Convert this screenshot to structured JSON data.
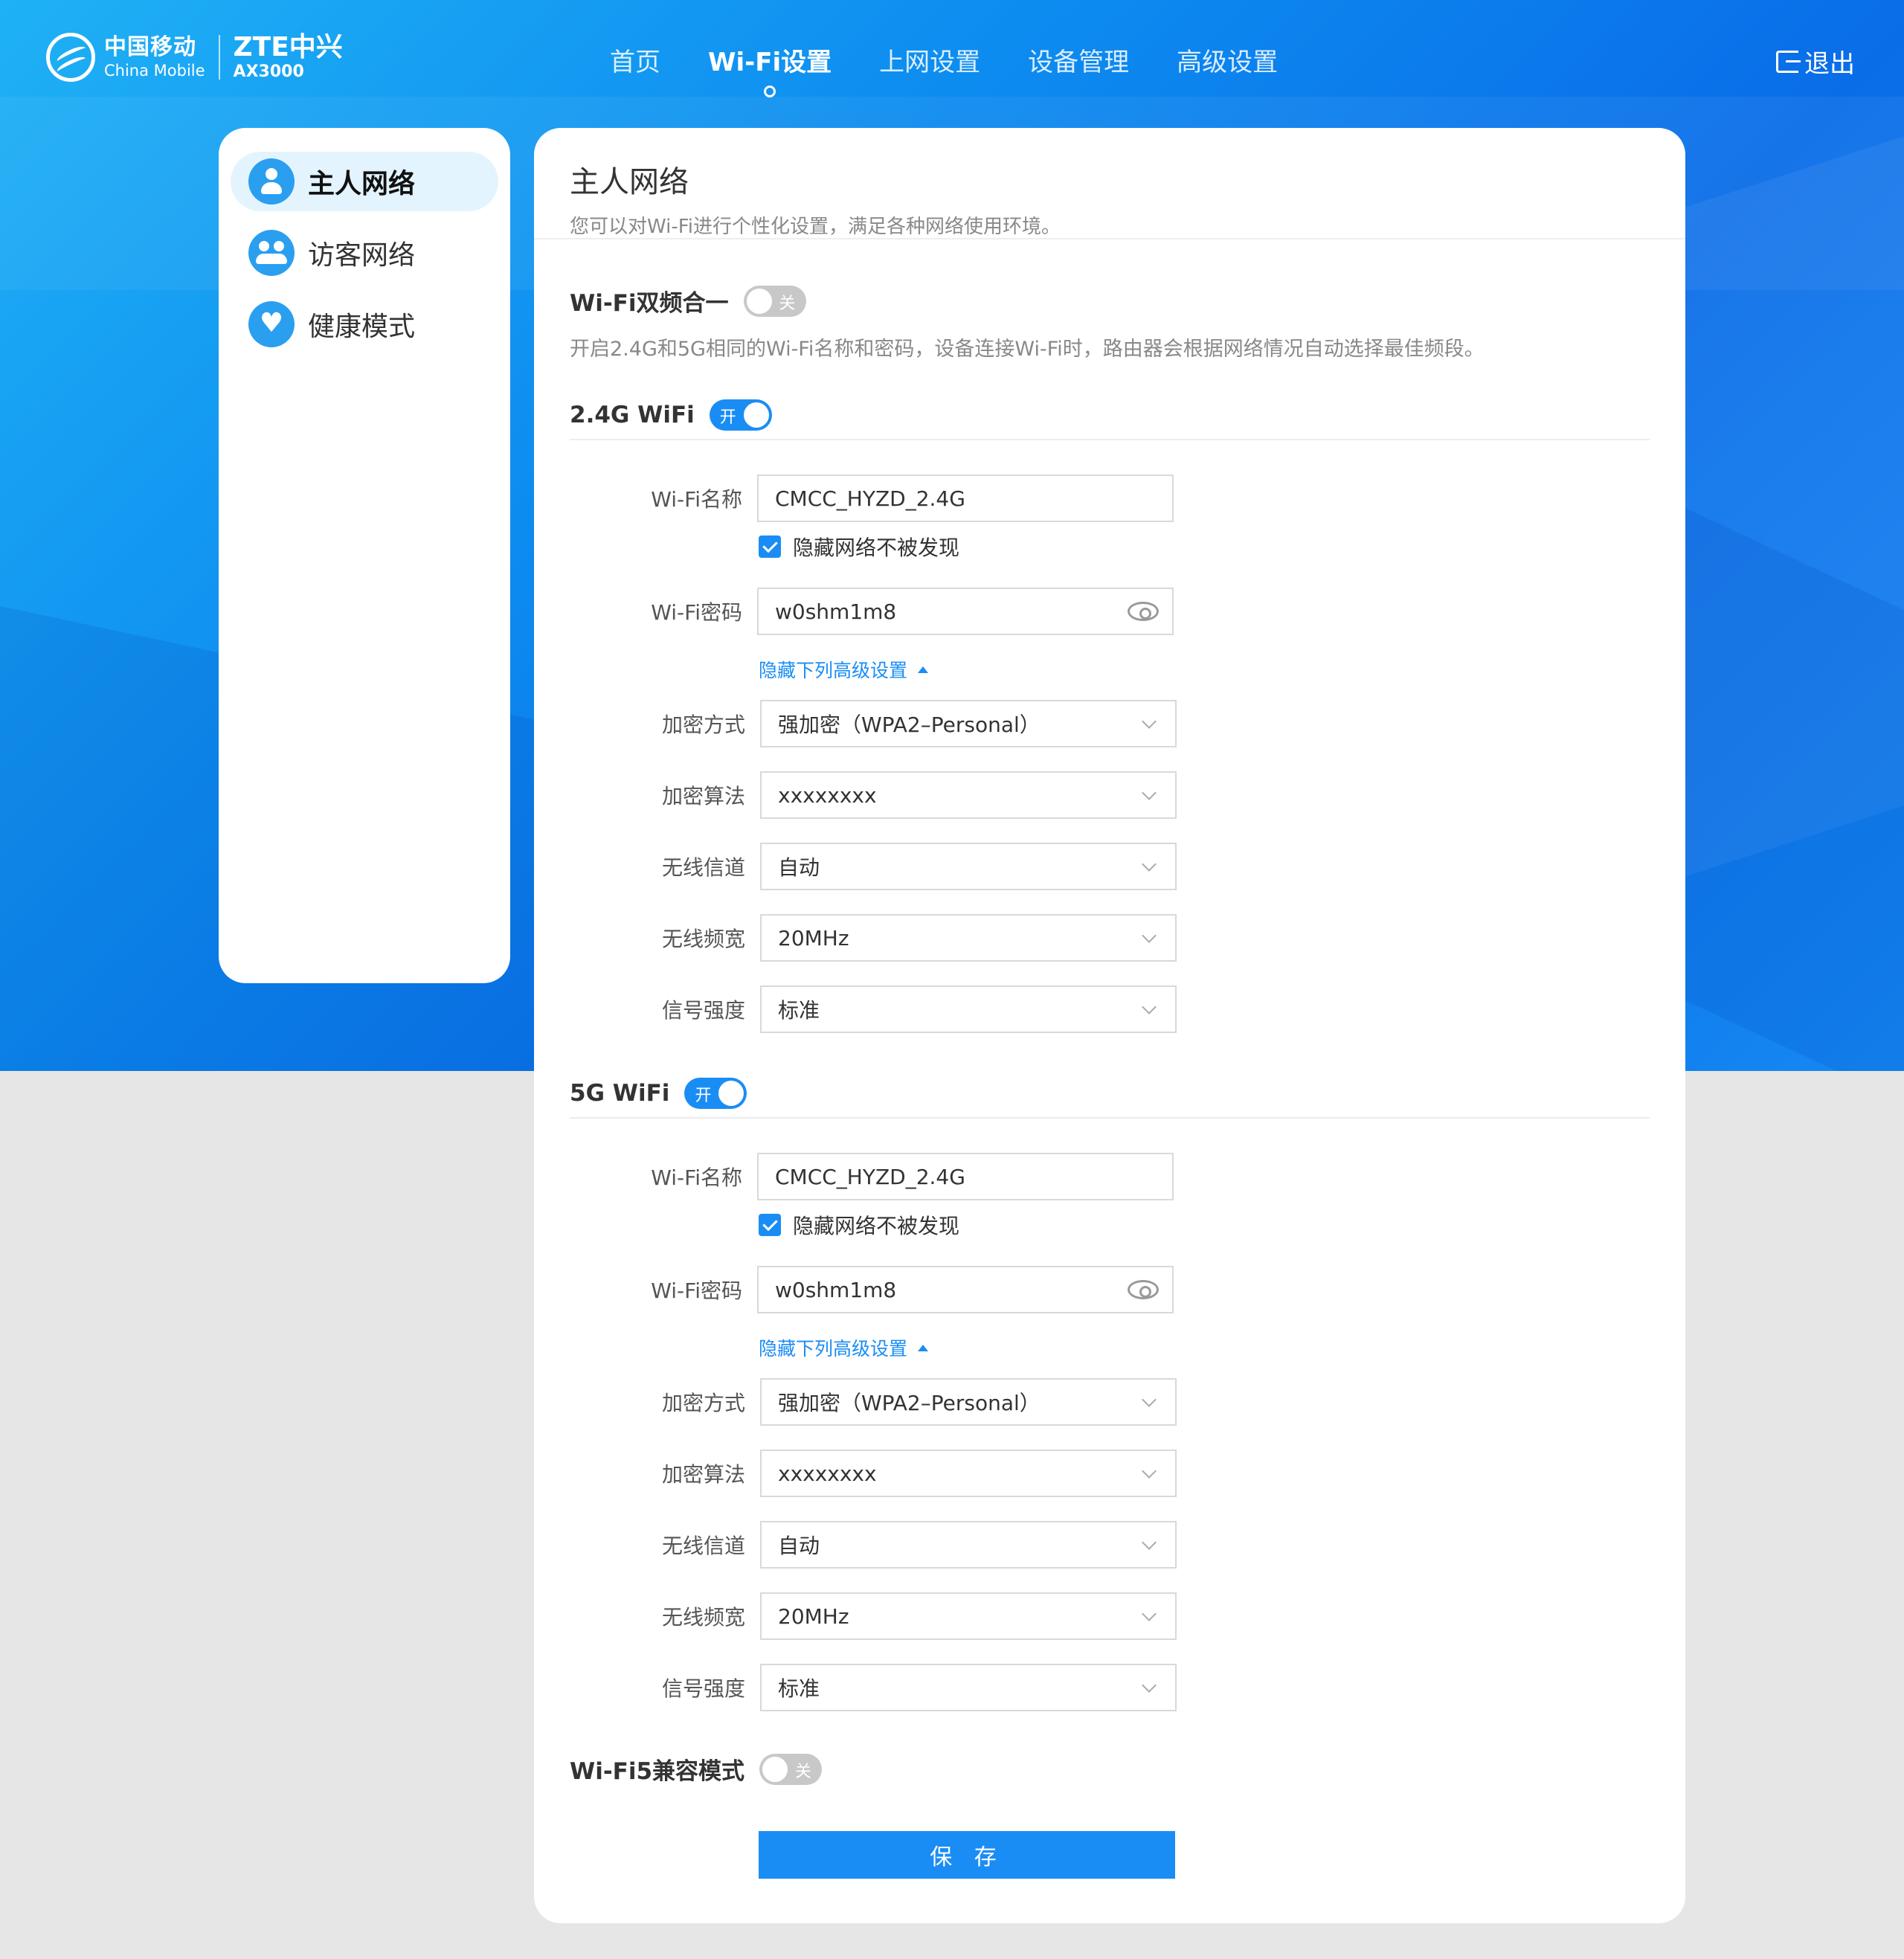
{
  "brand": {
    "cm_cn": "中国移动",
    "cm_en": "China Mobile",
    "zte": "ZTE中兴",
    "model": "AX3000"
  },
  "nav": {
    "items": [
      {
        "label": "首页"
      },
      {
        "label": "Wi-Fi设置",
        "active": true
      },
      {
        "label": "上网设置"
      },
      {
        "label": "设备管理"
      },
      {
        "label": "高级设置"
      }
    ],
    "logout": "退出"
  },
  "sidebar": {
    "items": [
      {
        "label": "主人网络",
        "icon": "user-icon",
        "active": true
      },
      {
        "label": "访客网络",
        "icon": "group-icon"
      },
      {
        "label": "健康模式",
        "icon": "heart-icon"
      }
    ]
  },
  "main": {
    "title": "主人网络",
    "subtitle": "您可以对Wi-Fi进行个性化设置，满足各种网络使用环境。",
    "dual_band": {
      "title": "Wi-Fi双频合一",
      "toggle": "关",
      "desc": "开启2.4G和5G相同的Wi-Fi名称和密码，设备连接Wi-Fi时，路由器会根据网络情况自动选择最佳频段。"
    },
    "wifi24": {
      "title": "2.4G WiFi",
      "toggle": "开",
      "name_label": "Wi-Fi名称",
      "name_value": "CMCC_HYZD_2.4G",
      "hide_label": "隐藏网络不被发现",
      "pwd_label": "Wi-Fi密码",
      "pwd_value": "w0shm1m8",
      "adv_link": "隐藏下列高级设置",
      "enc_mode_label": "加密方式",
      "enc_mode_value": "强加密（WPA2–Personal）",
      "enc_alg_label": "加密算法",
      "enc_alg_value": "xxxxxxxx",
      "channel_label": "无线信道",
      "channel_value": "自动",
      "bw_label": "无线频宽",
      "bw_value": "20MHz",
      "signal_label": "信号强度",
      "signal_value": "标准"
    },
    "wifi5": {
      "title": "5G WiFi",
      "toggle": "开",
      "name_label": "Wi-Fi名称",
      "name_value": "CMCC_HYZD_2.4G",
      "hide_label": "隐藏网络不被发现",
      "pwd_label": "Wi-Fi密码",
      "pwd_value": "w0shm1m8",
      "adv_link": "隐藏下列高级设置",
      "enc_mode_label": "加密方式",
      "enc_mode_value": "强加密（WPA2–Personal）",
      "enc_alg_label": "加密算法",
      "enc_alg_value": "xxxxxxxx",
      "channel_label": "无线信道",
      "channel_value": "自动",
      "bw_label": "无线频宽",
      "bw_value": "20MHz",
      "signal_label": "信号强度",
      "signal_value": "标准"
    },
    "wifi5_compat": {
      "title": "Wi-Fi5兼容模式",
      "toggle": "关"
    },
    "save": "保 存"
  },
  "colors": {
    "accent": "#1a8df5",
    "header_gradient_start": "#1fb1f5",
    "header_gradient_end": "#0a6de8",
    "page_bg": "#e6e6e6"
  }
}
